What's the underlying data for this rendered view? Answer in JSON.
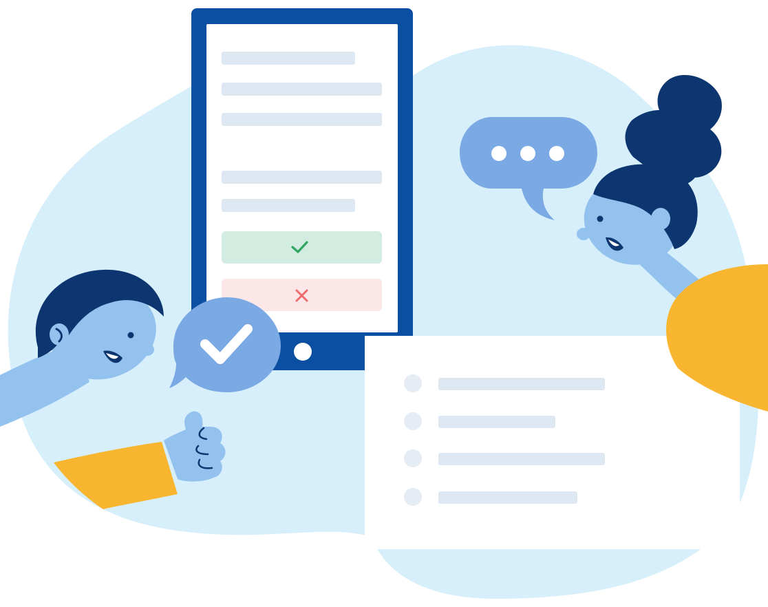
{
  "illustration": {
    "icons": {
      "phone": "tablet-icon",
      "approve": "checkmark-icon",
      "reject": "cross-icon",
      "typing": "ellipsis-icon",
      "thumbs": "thumbs-up-icon",
      "list_bullet": "bullet-icon"
    },
    "colors": {
      "background_blob": "#d6effa",
      "device_frame": "#0b4fa3",
      "device_screen": "#ffffff",
      "text_line": "#dde8f3",
      "approve_fill": "#d3ece1",
      "approve_mark": "#2fa561",
      "reject_fill": "#fbe6e8",
      "reject_mark": "#ef6b6b",
      "person_skin": "#94c2ef",
      "hair": "#0d3570",
      "sleeve": "#f8b630",
      "bubble": "#7aa9e3",
      "list_card": "#ffffff",
      "list_bullet": "#e6ecf3"
    },
    "list_rows": 4,
    "phone_lines": 5
  }
}
